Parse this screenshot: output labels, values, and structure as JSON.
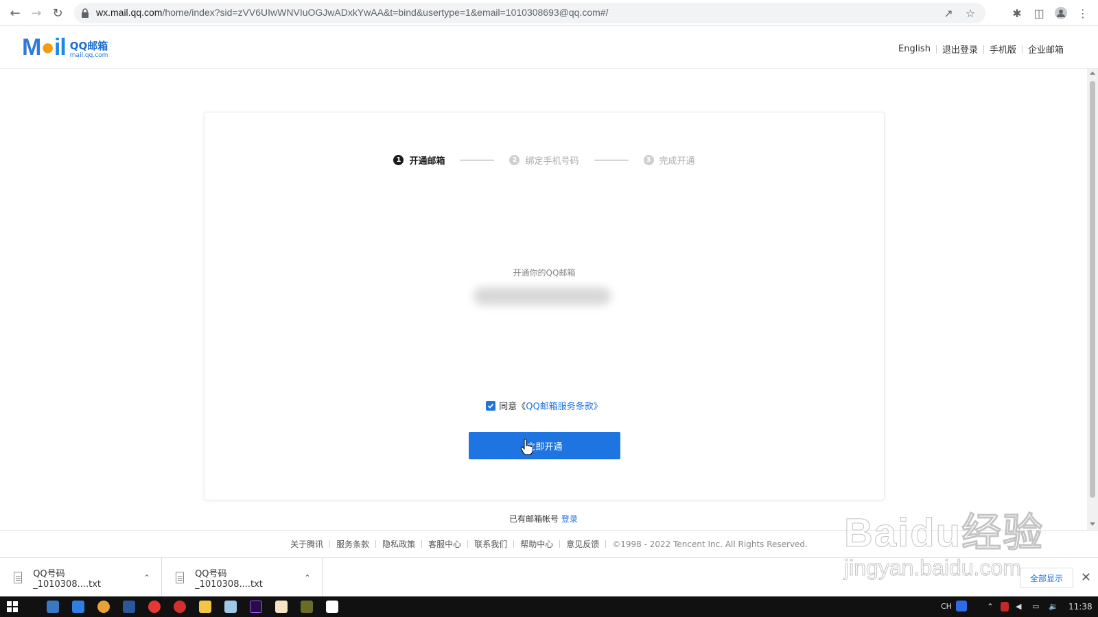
{
  "browser": {
    "url_host": "wx.mail.qq.com",
    "url_path": "/home/index?sid=zVV6UIwWNVIuOGJwADxkYwAA&t=bind&usertype=1&email=1010308693@qq.com#/"
  },
  "header": {
    "logo_text": "Mail",
    "logo_brand": "QQ邮箱",
    "logo_domain": "mail.qq.com",
    "links": [
      "English",
      "退出登录",
      "手机版",
      "企业邮箱"
    ]
  },
  "steps": [
    {
      "num": "1",
      "label": "开通邮箱",
      "state": "active"
    },
    {
      "num": "2",
      "label": "绑定手机号码",
      "state": "inactive"
    },
    {
      "num": "3",
      "label": "完成开通",
      "state": "inactive"
    }
  ],
  "main": {
    "open_label": "开通你的QQ邮箱",
    "agree_prefix": "同意《",
    "agree_link": "QQ邮箱服务条款",
    "agree_suffix": "》",
    "agree_checked": true,
    "submit_label": "立即开通",
    "has_account_text": "已有邮箱帐号",
    "login_link": "登录"
  },
  "footer": {
    "links": [
      "关于腾讯",
      "服务条款",
      "隐私政策",
      "客服中心",
      "联系我们",
      "帮助中心",
      "意见反馈"
    ],
    "copyright": "©1998 - 2022 Tencent Inc. All Rights Reserved."
  },
  "downloads": {
    "items": [
      "QQ号码_1010308....txt",
      "QQ号码_1010308....txt"
    ],
    "show_all": "全部显示"
  },
  "watermark": {
    "line1": "Baidu经验",
    "line2": "jingyan.baidu.com"
  },
  "taskbar": {
    "ime": "CH",
    "time": "11:38"
  },
  "colors": {
    "accent": "#1e74e0",
    "step_active": "#1a1a1a",
    "step_inactive": "#aaaaaa"
  }
}
